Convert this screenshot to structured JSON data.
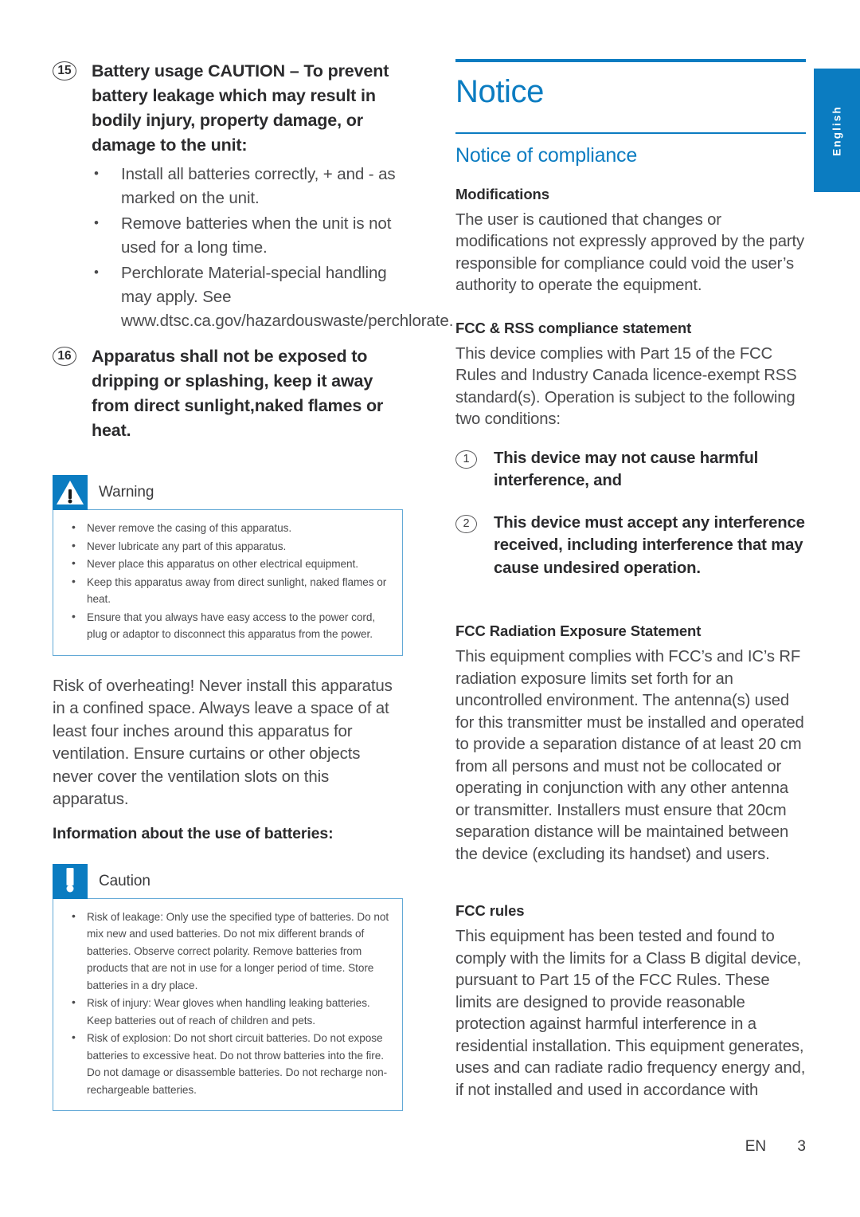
{
  "language_tab": {
    "label": "English"
  },
  "colors": {
    "brand_blue": "#0b7cc1",
    "box_border": "#63a9d6",
    "body_text": "#4b4b4d",
    "heading_text": "#2b2b2d"
  },
  "left_column": {
    "items": [
      {
        "number": "15",
        "text": "Battery usage CAUTION – To prevent battery leakage which may result in bodily injury, property damage, or damage to the unit:",
        "bullets": [
          "Install all batteries correctly, + and - as marked on the unit.",
          "Remove batteries when the unit is not used for a long time.",
          "Perchlorate Material-special handling may apply. See www.dtsc.ca.gov/hazardouswaste/perchlorate."
        ]
      },
      {
        "number": "16",
        "text": "Apparatus shall not be exposed to dripping or splashing, keep it away from direct sunlight,naked flames or heat.",
        "bullets": []
      }
    ],
    "warning_box": {
      "title": "Warning",
      "icon": "warning-triangle-icon",
      "bullets": [
        "Never remove the casing of this apparatus.",
        "Never lubricate any part of this apparatus.",
        "Never place this apparatus on other electrical equipment.",
        "Keep this apparatus away from direct sunlight, naked flames or heat.",
        "Ensure that you always have easy access to the power cord, plug or adaptor to disconnect this apparatus from the power."
      ]
    },
    "overheating_paragraph": "Risk of overheating! Never install this apparatus in a confined space. Always leave a space of at least four inches around this apparatus for ventilation. Ensure curtains or other objects never cover the ventilation slots on this apparatus.",
    "batteries_subheading": "Information about the use of batteries:",
    "caution_box": {
      "title": "Caution",
      "icon": "caution-exclamation-icon",
      "bullets": [
        "Risk of leakage: Only use the specified type of batteries. Do not mix new and used batteries. Do not mix different brands of batteries. Observe correct polarity. Remove batteries from products that are not in use for a longer period of time. Store batteries in a dry place.",
        "Risk of injury: Wear gloves when handling leaking batteries. Keep batteries out of reach of children and pets.",
        "Risk of explosion: Do not short circuit batteries. Do not expose batteries to excessive heat. Do not throw batteries into the fire. Do not damage or disassemble batteries. Do not recharge non-rechargeable batteries."
      ]
    }
  },
  "right_column": {
    "page_title": "Notice",
    "section_title": "Notice of compliance",
    "modifications": {
      "heading": "Modifications",
      "body": "The user is cautioned that changes or modifications not expressly approved by the party responsible for compliance could void the user’s authority to operate the equipment."
    },
    "fcc_rss": {
      "heading": "FCC & RSS compliance statement",
      "body": "This device complies with Part 15 of the FCC Rules and Industry Canada licence-exempt RSS standard(s). Operation is subject to the following two conditions:",
      "conditions": [
        {
          "number": "1",
          "text": "This device may not cause harmful interference, and"
        },
        {
          "number": "2",
          "text": "This device must accept any interference received, including interference that may cause undesired operation."
        }
      ]
    },
    "radiation": {
      "heading": "FCC Radiation Exposure Statement",
      "body": "This equipment complies with FCC’s and IC’s RF radiation exposure limits set forth for an uncontrolled environment. The antenna(s) used for this transmitter must be installed and operated to provide a separation distance of at least 20 cm from all persons and must not be collocated or operating in conjunction with any other antenna or transmitter. Installers must ensure that 20cm separation distance will be maintained between the device (excluding its handset) and users."
    },
    "fcc_rules": {
      "heading": "FCC rules",
      "body": "This equipment has been tested and found to comply with the limits for a Class B digital device, pursuant to Part 15 of the FCC Rules. These limits are designed to provide reasonable protection against harmful interference in a residential installation. This equipment generates, uses and can radiate radio frequency energy and, if not installed and used in accordance with"
    }
  },
  "footer": {
    "language_code": "EN",
    "page_number": "3"
  }
}
